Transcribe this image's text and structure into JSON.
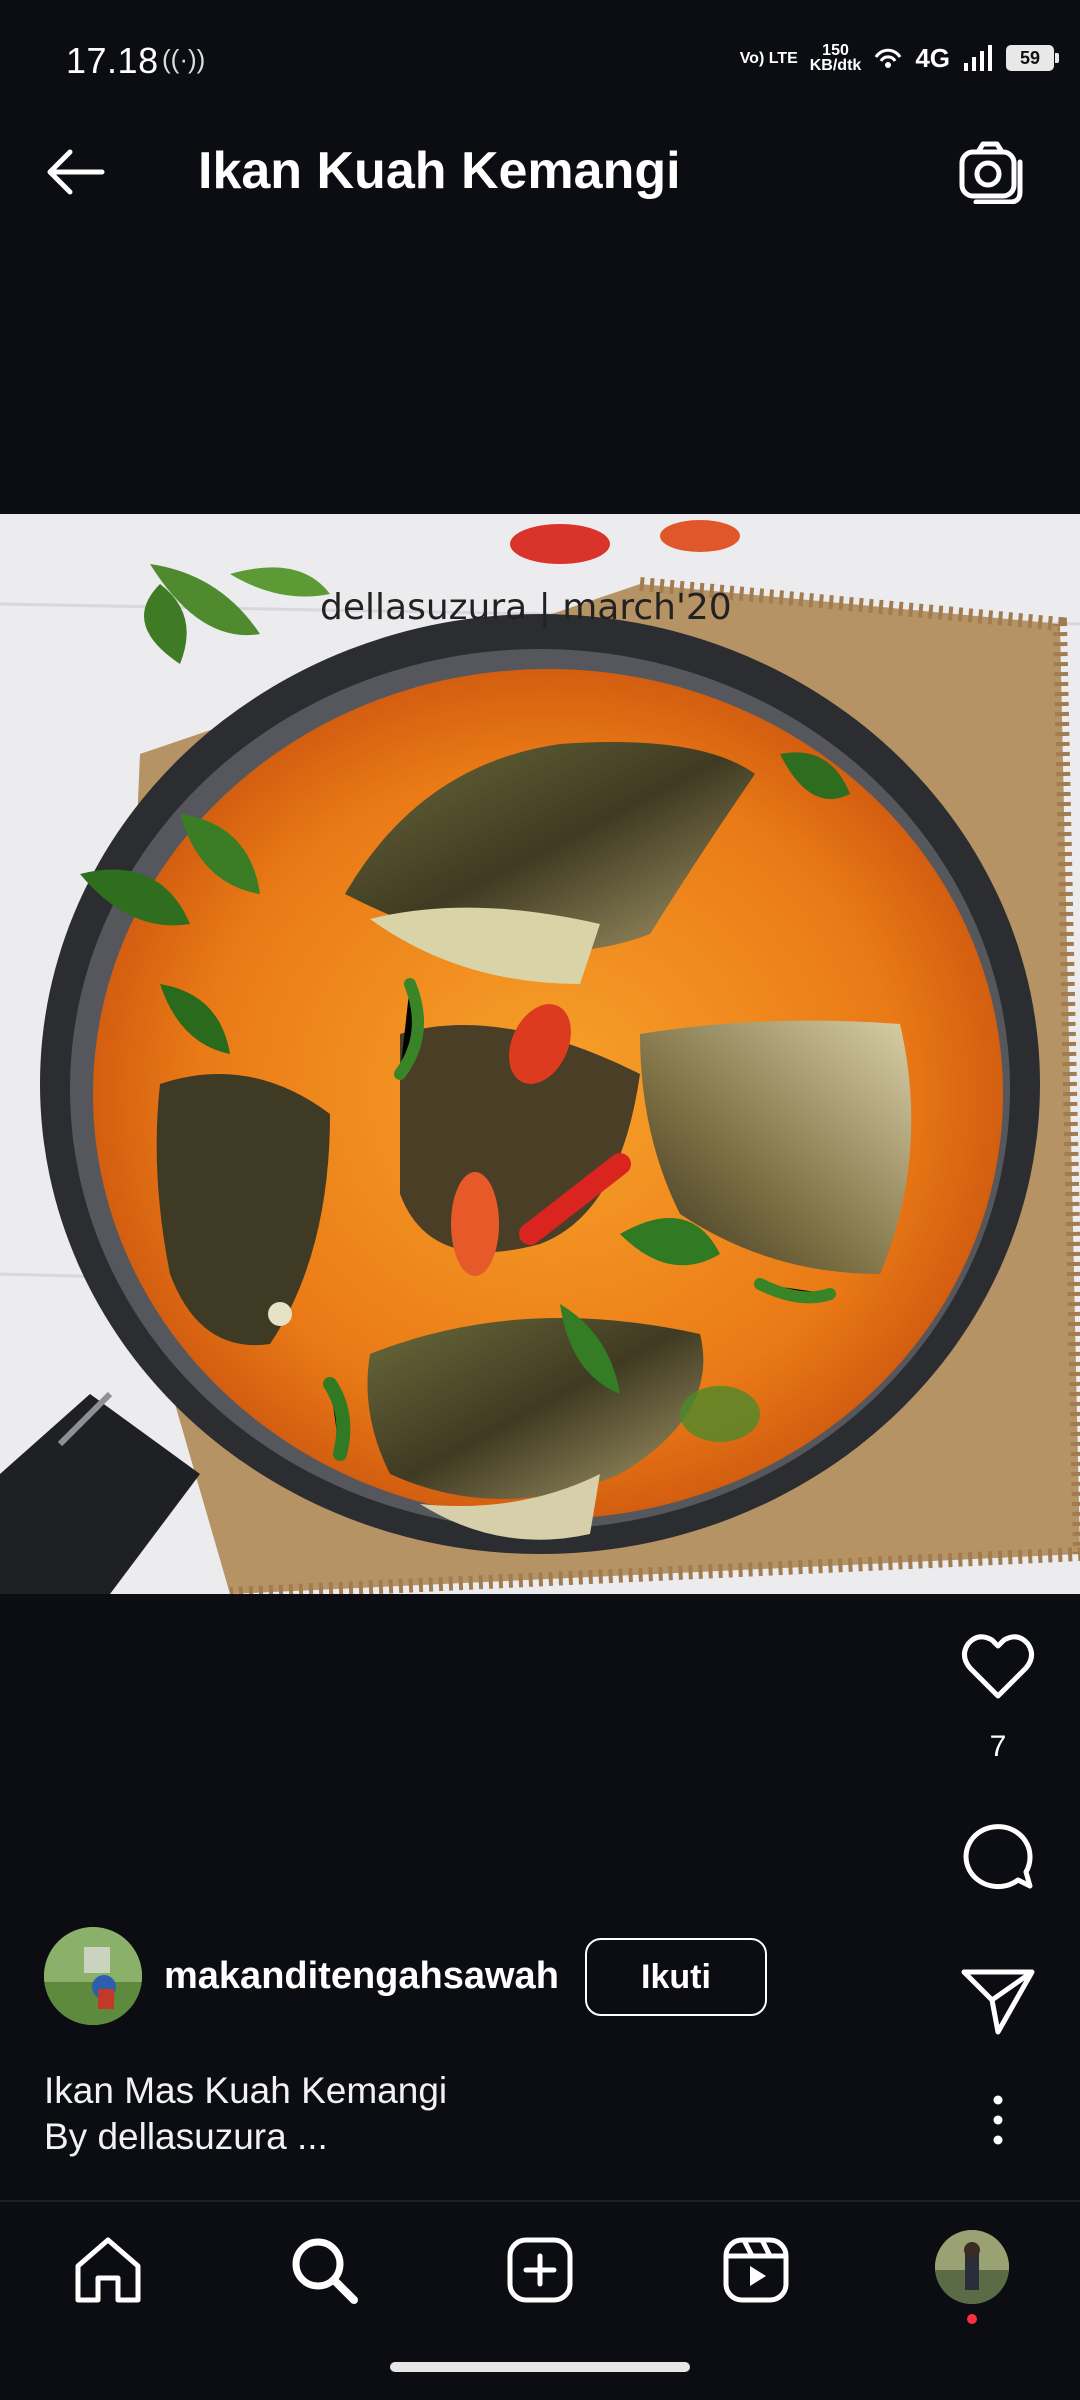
{
  "status_bar": {
    "time": "17.18",
    "volte": "Vo) LTE",
    "speed_value": "150",
    "speed_unit": "KB/dtk",
    "network": "4G",
    "battery": "59"
  },
  "header": {
    "title": "Ikan Kuah Kemangi"
  },
  "photo": {
    "watermark": "dellasuzura | march'20"
  },
  "actions": {
    "like_count": "7"
  },
  "post": {
    "username": "makanditengahsawah",
    "follow_label": "Ikuti",
    "caption_line1": "Ikan Mas Kuah Kemangi",
    "caption_line2": "By dellasuzura ..."
  },
  "icons": {
    "back": "arrow-left-icon",
    "camera": "camera-icon",
    "like": "heart-icon",
    "comment": "comment-icon",
    "share": "send-icon",
    "more": "more-vertical-icon",
    "nav": [
      "home-icon",
      "search-icon",
      "add-icon",
      "reels-icon",
      "profile-avatar"
    ]
  }
}
